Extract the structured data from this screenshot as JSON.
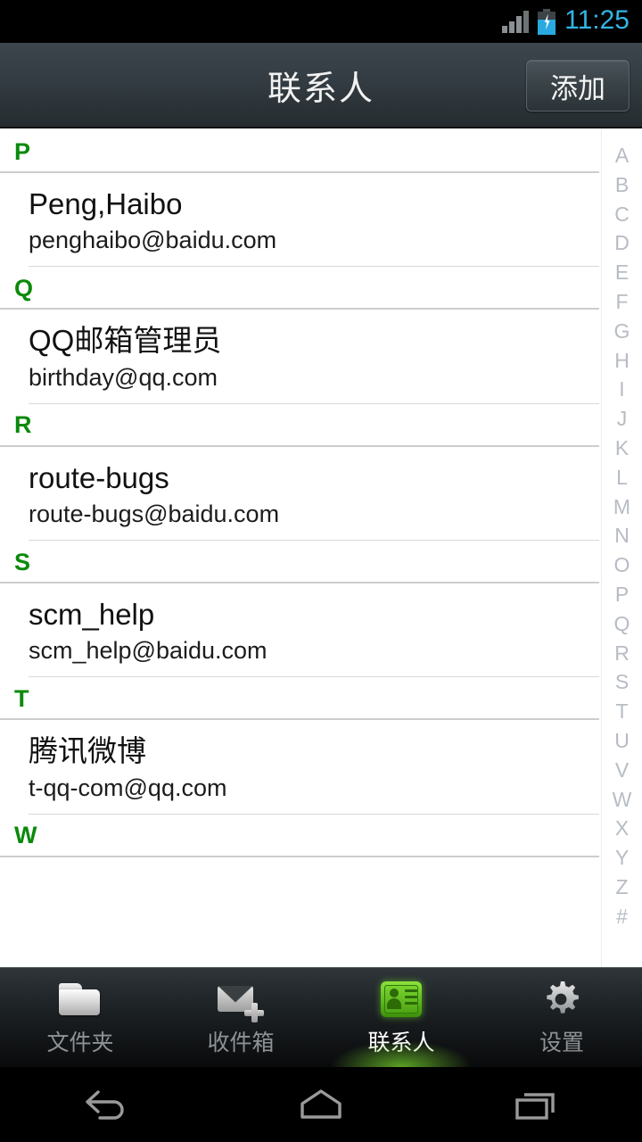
{
  "statusbar": {
    "time": "11:25",
    "signal_icon": "signal-bars-icon",
    "battery_icon": "battery-charging-icon"
  },
  "actionbar": {
    "title": "联系人",
    "add_label": "添加"
  },
  "list": {
    "sections": [
      {
        "letter": "P",
        "contacts": [
          {
            "name": "Peng,Haibo",
            "email": "penghaibo@baidu.com"
          }
        ]
      },
      {
        "letter": "Q",
        "contacts": [
          {
            "name": "QQ邮箱管理员",
            "email": "birthday@qq.com"
          }
        ]
      },
      {
        "letter": "R",
        "contacts": [
          {
            "name": "route-bugs",
            "email": "route-bugs@baidu.com"
          }
        ]
      },
      {
        "letter": "S",
        "contacts": [
          {
            "name": "scm_help",
            "email": "scm_help@baidu.com"
          }
        ]
      },
      {
        "letter": "T",
        "contacts": [
          {
            "name": "腾讯微博",
            "email": "t-qq-com@qq.com"
          }
        ]
      },
      {
        "letter": "W",
        "contacts": []
      }
    ]
  },
  "alpha_index": [
    "A",
    "B",
    "C",
    "D",
    "E",
    "F",
    "G",
    "H",
    "I",
    "J",
    "K",
    "L",
    "M",
    "N",
    "O",
    "P",
    "Q",
    "R",
    "S",
    "T",
    "U",
    "V",
    "W",
    "X",
    "Y",
    "Z",
    "#"
  ],
  "tabbar": {
    "tabs": [
      {
        "label": "文件夹",
        "icon": "folder-icon",
        "active": false
      },
      {
        "label": "收件箱",
        "icon": "mail-add-icon",
        "active": false
      },
      {
        "label": "联系人",
        "icon": "contact-card-icon",
        "active": true
      },
      {
        "label": "设置",
        "icon": "gear-icon",
        "active": false
      }
    ]
  },
  "navbar": {
    "back": "back-icon",
    "home": "home-icon",
    "recents": "recents-icon"
  },
  "colors": {
    "accent_green": "#0b8a0b",
    "tab_active_green": "#76d62d",
    "clock_blue": "#33b5e5",
    "battery_blue": "#29a9e0"
  }
}
